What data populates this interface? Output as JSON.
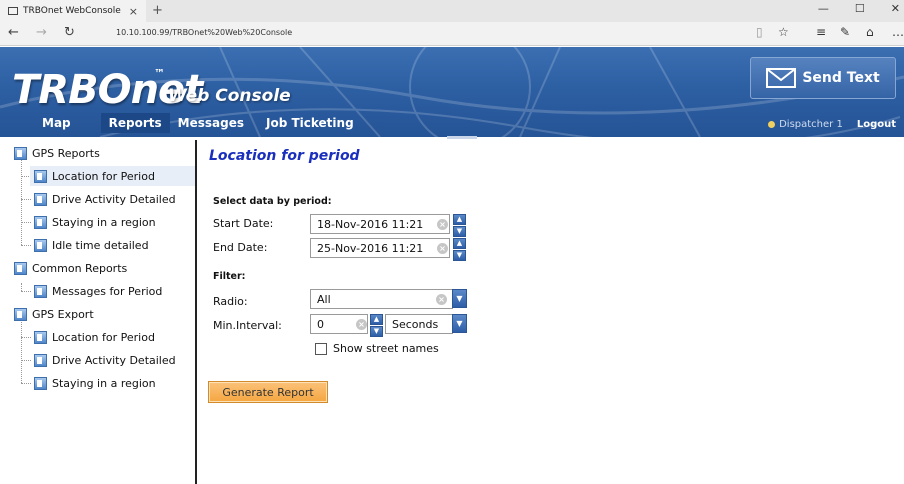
{
  "browser": {
    "tab_title": "TRBOnet WebConsole",
    "url": "10.10.100.99/TRBOnet%20Web%20Console",
    "new_tab": "+",
    "tab_close": "×"
  },
  "header": {
    "logo": "TRBOnet",
    "trademark": "™",
    "subtitle": "Web Console",
    "menu": [
      "Map",
      "Reports",
      "Messages",
      "Job Ticketing"
    ],
    "active_menu": "Reports",
    "send_text": "Send Text",
    "dispatcher": "Dispatcher 1",
    "logout": "Logout"
  },
  "tree": {
    "groups": [
      {
        "label": "GPS Reports",
        "children": [
          "Location for Period",
          "Drive Activity Detailed",
          "Staying in a region",
          "Idle time detailed"
        ]
      },
      {
        "label": "Common Reports",
        "children": [
          "Messages for Period"
        ]
      },
      {
        "label": "GPS Export",
        "children": [
          "Location for Period",
          "Drive Activity Detailed",
          "Staying in a region"
        ]
      }
    ],
    "selected": "Location for Period"
  },
  "form": {
    "title": "Location for period",
    "select_label": "Select data by period:",
    "start_label": "Start Date:",
    "start_value": "18-Nov-2016 11:21",
    "end_label": "End Date:",
    "end_value": "25-Nov-2016 11:21",
    "filter_label": "Filter:",
    "radio_label": "Radio:",
    "radio_value": "All",
    "interval_label": "Min.Interval:",
    "interval_value": "0",
    "interval_unit": "Seconds",
    "street_label": "Show street names",
    "street_checked": false,
    "generate": "Generate Report"
  },
  "colors": {
    "header_blue": "#2d5fa3",
    "title_blue": "#1a2fbd",
    "button_orange": "#f5a640"
  }
}
